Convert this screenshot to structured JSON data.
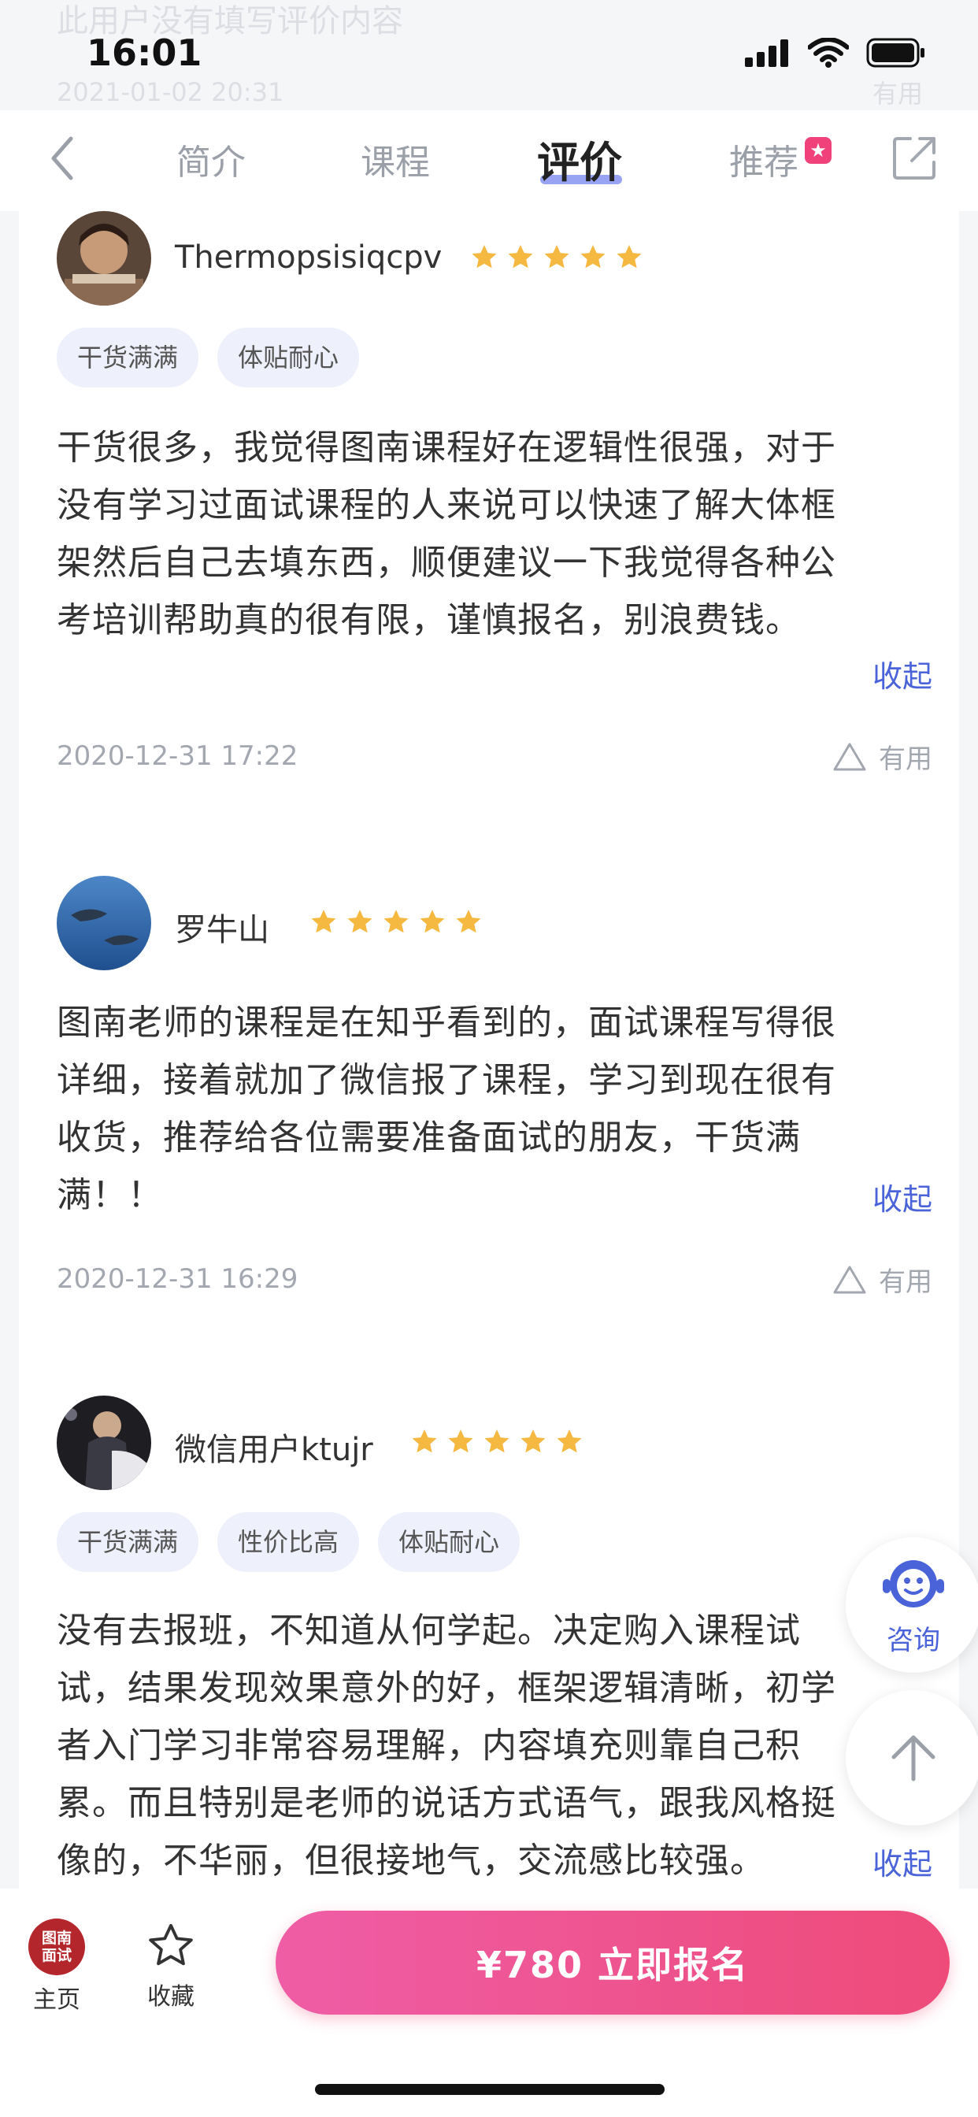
{
  "ghost_review": {
    "text": "此用户没有填写评价内容",
    "date": "2021-01-02 20:31",
    "useful": "有用"
  },
  "status_bar": {
    "time": "16:01"
  },
  "navbar": {
    "tabs": [
      {
        "label": "简介"
      },
      {
        "label": "课程"
      },
      {
        "label": "评价"
      },
      {
        "label": "推荐"
      }
    ],
    "active_tab": "评价"
  },
  "reviews": [
    {
      "user": "Thermopsisiqcpv",
      "rating": 5,
      "tags": [
        "干货满满",
        "体贴耐心"
      ],
      "lines": [
        "干货很多，我觉得图南课程好在逻辑性很强，对于",
        "没有学习过面试课程的人来说可以快速了解大体框",
        "架然后自己去填东西，顺便建议一下我觉得各种公",
        "考培训帮助真的很有限，谨慎报名，别浪费钱。"
      ],
      "collapse": "收起",
      "date": "2020-12-31 17:22",
      "useful": "有用"
    },
    {
      "user": "罗牛山",
      "rating": 5,
      "tags": [],
      "lines": [
        "图南老师的课程是在知乎看到的，面试课程写得很",
        "详细，接着就加了微信报了课程，学习到现在很有",
        "收货，推荐给各位需要准备面试的朋友，干货满",
        "满！！"
      ],
      "collapse": "收起",
      "date": "2020-12-31 16:29",
      "useful": "有用"
    },
    {
      "user": "微信用户ktujr",
      "rating": 5,
      "tags": [
        "干货满满",
        "性价比高",
        "体贴耐心"
      ],
      "lines": [
        "没有去报班，不知道从何学起。决定购入课程试",
        "试，结果发现效果意外的好，框架逻辑清晰，初学",
        "者入门学习非常容易理解，内容填充则靠自己积",
        "累。而且特别是老师的说话方式语气，跟我风格挺",
        "像的，不华丽，但很接地气，交流感比较强。"
      ],
      "collapse": "收起"
    }
  ],
  "floating": {
    "consult_label": "咨询"
  },
  "bottom_bar": {
    "logo_text_1": "图南",
    "logo_text_2": "面试",
    "home_label": "主页",
    "favorite_label": "收藏",
    "buy_label": "¥780  立即报名"
  },
  "colors": {
    "accent_blue": "#4a63d8",
    "star_gold": "#f5b942",
    "buy_gradient_start": "#ef5da6",
    "buy_gradient_end": "#ee4b79"
  }
}
